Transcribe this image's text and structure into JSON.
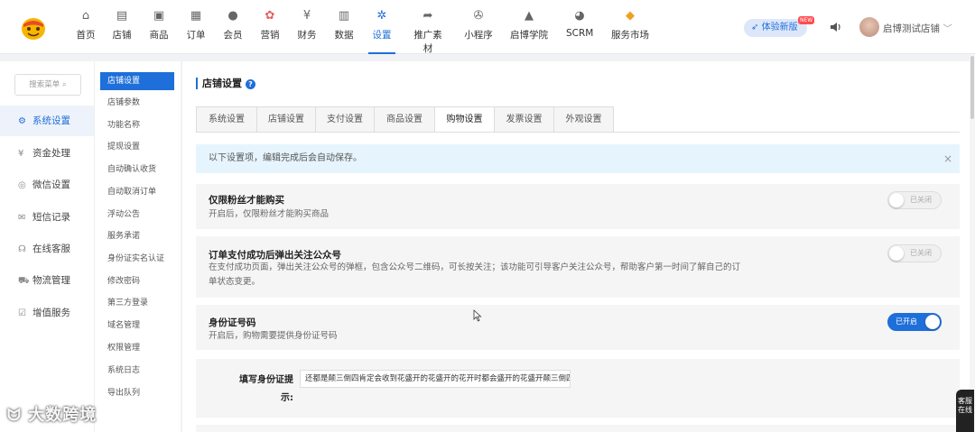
{
  "header": {
    "nav": [
      {
        "label": "首页",
        "icon": "home-icon"
      },
      {
        "label": "店铺",
        "icon": "store-icon"
      },
      {
        "label": "商品",
        "icon": "product-icon"
      },
      {
        "label": "订单",
        "icon": "order-icon"
      },
      {
        "label": "会员",
        "icon": "member-icon"
      },
      {
        "label": "营销",
        "icon": "marketing-icon"
      },
      {
        "label": "财务",
        "icon": "finance-icon"
      },
      {
        "label": "数据",
        "icon": "data-icon"
      },
      {
        "label": "设置",
        "icon": "settings-icon"
      },
      {
        "label": "推广素材",
        "icon": "share-icon"
      },
      {
        "label": "小程序",
        "icon": "miniprogram-icon"
      },
      {
        "label": "启博学院",
        "icon": "academy-icon"
      },
      {
        "label": "SCRM",
        "icon": "scrm-icon"
      },
      {
        "label": "服务市场",
        "icon": "market-icon"
      }
    ],
    "try_new": "体验新版",
    "new_badge": "NEW",
    "store_name": "启博测试店铺"
  },
  "left_nav": {
    "search_placeholder": "搜索菜单",
    "items": [
      {
        "label": "系统设置",
        "icon": "gear-icon"
      },
      {
        "label": "资金处理",
        "icon": "yen-icon"
      },
      {
        "label": "微信设置",
        "icon": "wechat-icon"
      },
      {
        "label": "短信记录",
        "icon": "mail-icon"
      },
      {
        "label": "在线客服",
        "icon": "headset-icon"
      },
      {
        "label": "物流管理",
        "icon": "truck-icon"
      },
      {
        "label": "增值服务",
        "icon": "chart-icon"
      }
    ]
  },
  "sub_nav": {
    "items": [
      "店铺设置",
      "店铺参数",
      "功能名称",
      "提现设置",
      "自动确认收货",
      "自动取消订单",
      "浮动公告",
      "服务承诺",
      "身份证实名认证",
      "修改密码",
      "第三方登录",
      "域名管理",
      "权限管理",
      "系统日志",
      "导出队列"
    ]
  },
  "main": {
    "title": "店铺设置",
    "tabs": [
      "系统设置",
      "店铺设置",
      "支付设置",
      "商品设置",
      "购物设置",
      "发票设置",
      "外观设置"
    ],
    "notice": "以下设置项，编辑完成后会自动保存。",
    "settings": [
      {
        "title": "仅限粉丝才能购买",
        "desc": "开启后，仅限粉丝才能购买商品",
        "state": "已关闭"
      },
      {
        "title": "订单支付成功后弹出关注公众号",
        "desc": "在支付成功页面，弹出关注公众号的弹框，包含公众号二维码，可长按关注；该功能可引导客户关注公众号，帮助客户第一时间了解自己的订单状态变更。",
        "state": "已关闭"
      },
      {
        "title": "身份证号码",
        "desc": "开启后，购物需要提供身份证号码",
        "state": "已开启"
      }
    ],
    "id_prompt_label": "填写身份证提示:",
    "id_prompt_value": "还都是颠三倒四肯定会收到花盛开的花盛开的花开时都会盛开的花盛开颠三倒四"
  },
  "overlay": {
    "watermark": "大数跨境",
    "service": "客服在线"
  }
}
